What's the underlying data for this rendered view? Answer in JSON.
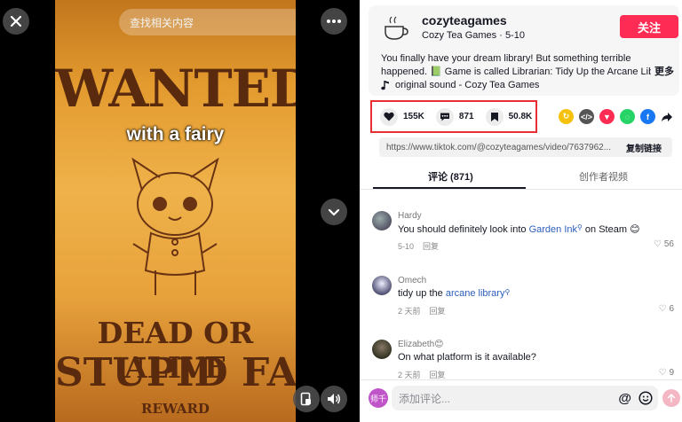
{
  "video": {
    "search_placeholder": "查找相关内容",
    "poster_title": "WANTED",
    "subtitle": "with a fairy",
    "poster_line1": "DEAD OR ALIVE",
    "poster_line2": "STUPID FAIRY",
    "poster_reward": "REWARD"
  },
  "header": {
    "username": "cozyteagames",
    "handle": "Cozy Tea Games · 5-10",
    "follow_label": "关注",
    "description_line1": "You finally have your dream library! But something terrible",
    "description_line2": "happened. 📗 Game is called Librarian: Tidy Up the Arcane Librar...",
    "more_label": "更多",
    "sound": "original sound - Cozy Tea Games"
  },
  "stats": {
    "likes": "155K",
    "comments": "871",
    "saves": "50.8K"
  },
  "share": {
    "url": "https://www.tiktok.com/@cozyteagames/video/7637962...",
    "copy_label": "复制链接"
  },
  "tabs": {
    "comments": "评论 (871)",
    "creator_videos": "创作者视频"
  },
  "comments": [
    {
      "author": "Hardy",
      "text_before": "You should definitely look into ",
      "link": "Garden Ink",
      "text_after": " on Steam 😊",
      "date": "5-10",
      "reply": "回复",
      "likes": "56"
    },
    {
      "author": "Omech",
      "text_before": "tidy up the ",
      "link": "arcane library",
      "text_after": "",
      "date": "2 天前",
      "reply": "回复",
      "likes": "6"
    },
    {
      "author": "Elizabeth😊",
      "text_before": "On what platform is it available?",
      "link": "",
      "text_after": "",
      "date": "2 天前",
      "reply": "回复",
      "likes": "9"
    }
  ],
  "input": {
    "placeholder": "添加评论...",
    "my_avatar_text": "师千"
  },
  "colors": {
    "accent": "#fe2c55",
    "highlight_box": "#e62e34",
    "link": "#2b5db9"
  }
}
